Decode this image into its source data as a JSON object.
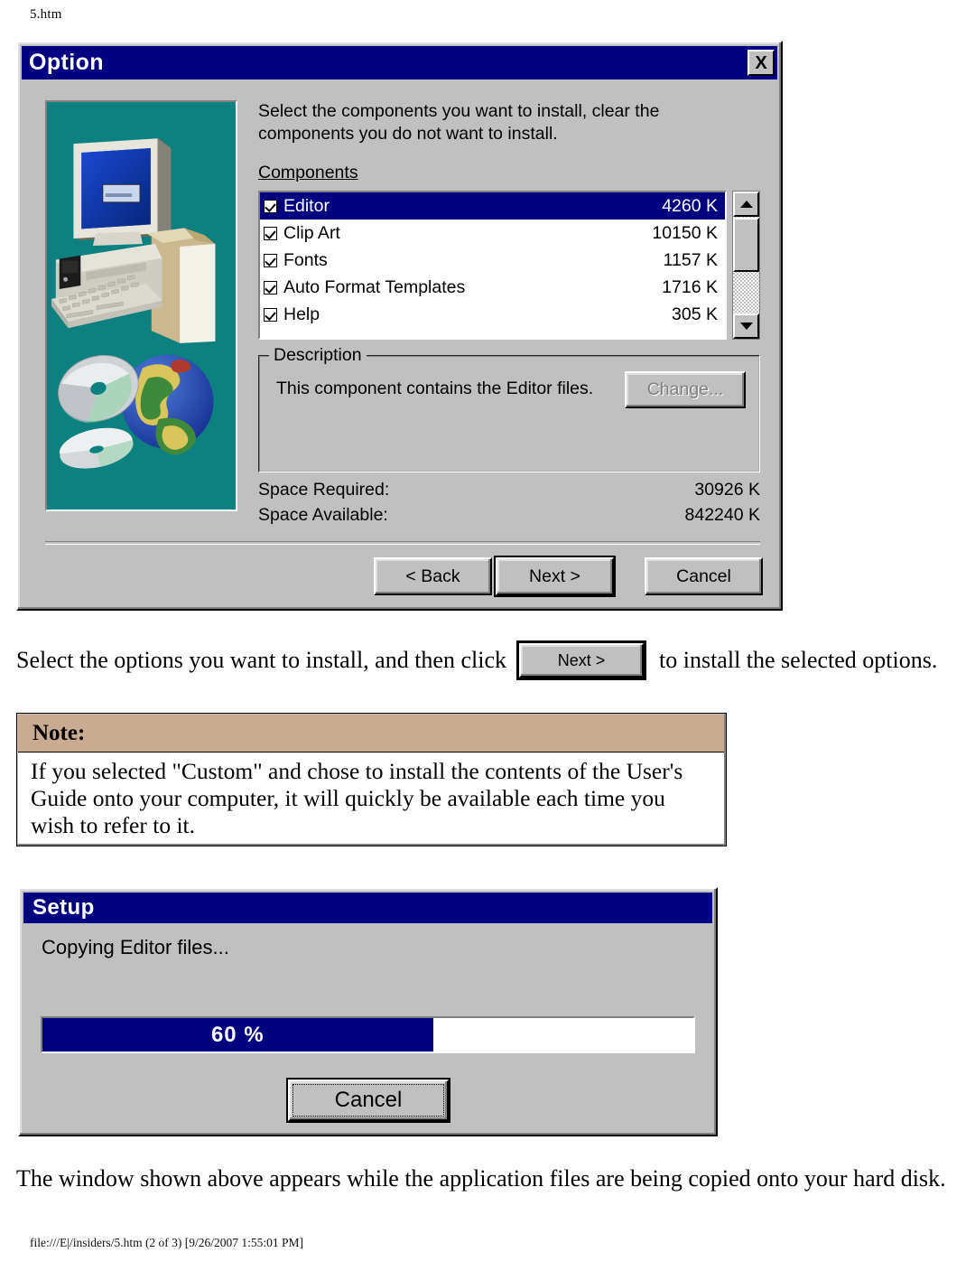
{
  "page": {
    "header": "5.htm",
    "footer": "file:///E|/insiders/5.htm (2 of 3) [9/26/2007 1:55:01 PM]"
  },
  "colors": {
    "titlebar": "#000080",
    "dialog_face": "#c0c0c0",
    "illustration_bg": "#0d8080",
    "note_header_bg": "#c9ab91",
    "progress_fill": "#000080",
    "selection": "#000080"
  },
  "option_dialog": {
    "title": "Option",
    "close_label": "X",
    "instruction": "Select the components you want to install, clear the components you do not want to install.",
    "components_label": "Components",
    "components": [
      {
        "name": "Editor",
        "size": "4260 K",
        "checked": true,
        "selected": true
      },
      {
        "name": "Clip Art",
        "size": "10150 K",
        "checked": true,
        "selected": false
      },
      {
        "name": "Fonts",
        "size": "1157 K",
        "checked": true,
        "selected": false
      },
      {
        "name": "Auto Format Templates",
        "size": "1716 K",
        "checked": true,
        "selected": false
      },
      {
        "name": "Help",
        "size": "305 K",
        "checked": true,
        "selected": false
      }
    ],
    "description_group_title": "Description",
    "description_text": "This component contains the Editor files.",
    "change_button": "Change...",
    "space_required_label": "Space Required:",
    "space_required_value": "30926 K",
    "space_available_label": "Space Available:",
    "space_available_value": "842240 K",
    "buttons": {
      "back": "< Back",
      "next": "Next >",
      "cancel": "Cancel"
    }
  },
  "paragraph_1": {
    "before": "Select the options you want to install, and then click",
    "button_label": "Next >",
    "after": "to install the selected options."
  },
  "note": {
    "heading": "Note:",
    "body": "If you selected \"Custom\" and chose to install the contents of the User's Guide onto your computer, it will quickly be available each time you wish to refer to it."
  },
  "setup_dialog": {
    "title": "Setup",
    "status": "Copying Editor files...",
    "progress_percent": 60,
    "progress_label": "60 %",
    "cancel_button": "Cancel"
  },
  "paragraph_2": "The window shown above appears while the application files are being copied onto your hard disk."
}
